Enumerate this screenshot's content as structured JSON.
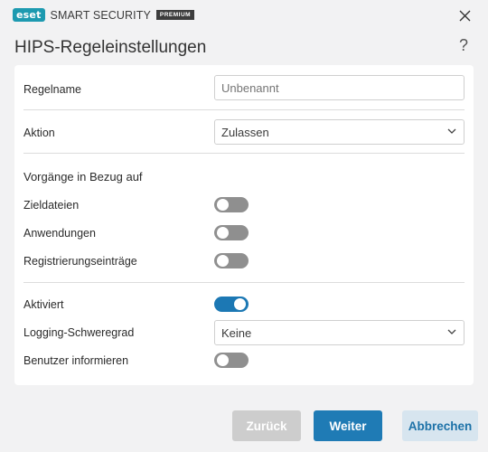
{
  "window": {
    "logo_text": "eset",
    "product_name": "SMART SECURITY",
    "edition_badge": "PREMIUM",
    "icons": {
      "close": "close-icon",
      "help": "help-icon",
      "chevron": "chevron-down-icon"
    }
  },
  "dialog": {
    "title": "HIPS-Regeleinstellungen",
    "help_symbol": "?"
  },
  "form": {
    "rule_name": {
      "label": "Regelname",
      "value": "",
      "placeholder": "Unbenannt"
    },
    "action": {
      "label": "Aktion",
      "selected": "Zulassen"
    },
    "operations": {
      "heading": "Vorgänge in Bezug auf",
      "target_files": {
        "label": "Zieldateien",
        "enabled": false
      },
      "applications": {
        "label": "Anwendungen",
        "enabled": false
      },
      "registry_entries": {
        "label": "Registrierungseinträge",
        "enabled": false
      }
    },
    "activated": {
      "label": "Aktiviert",
      "enabled": true
    },
    "logging_severity": {
      "label": "Logging-Schweregrad",
      "selected": "Keine"
    },
    "notify_user": {
      "label": "Benutzer informieren",
      "enabled": false
    }
  },
  "buttons": {
    "back": "Zurück",
    "next": "Weiter",
    "cancel": "Abbrechen"
  },
  "colors": {
    "accent": "#1f7bb5",
    "brand": "#1d9ab0",
    "toggle_off": "#8f8f8f",
    "background": "#f2f2f3"
  }
}
